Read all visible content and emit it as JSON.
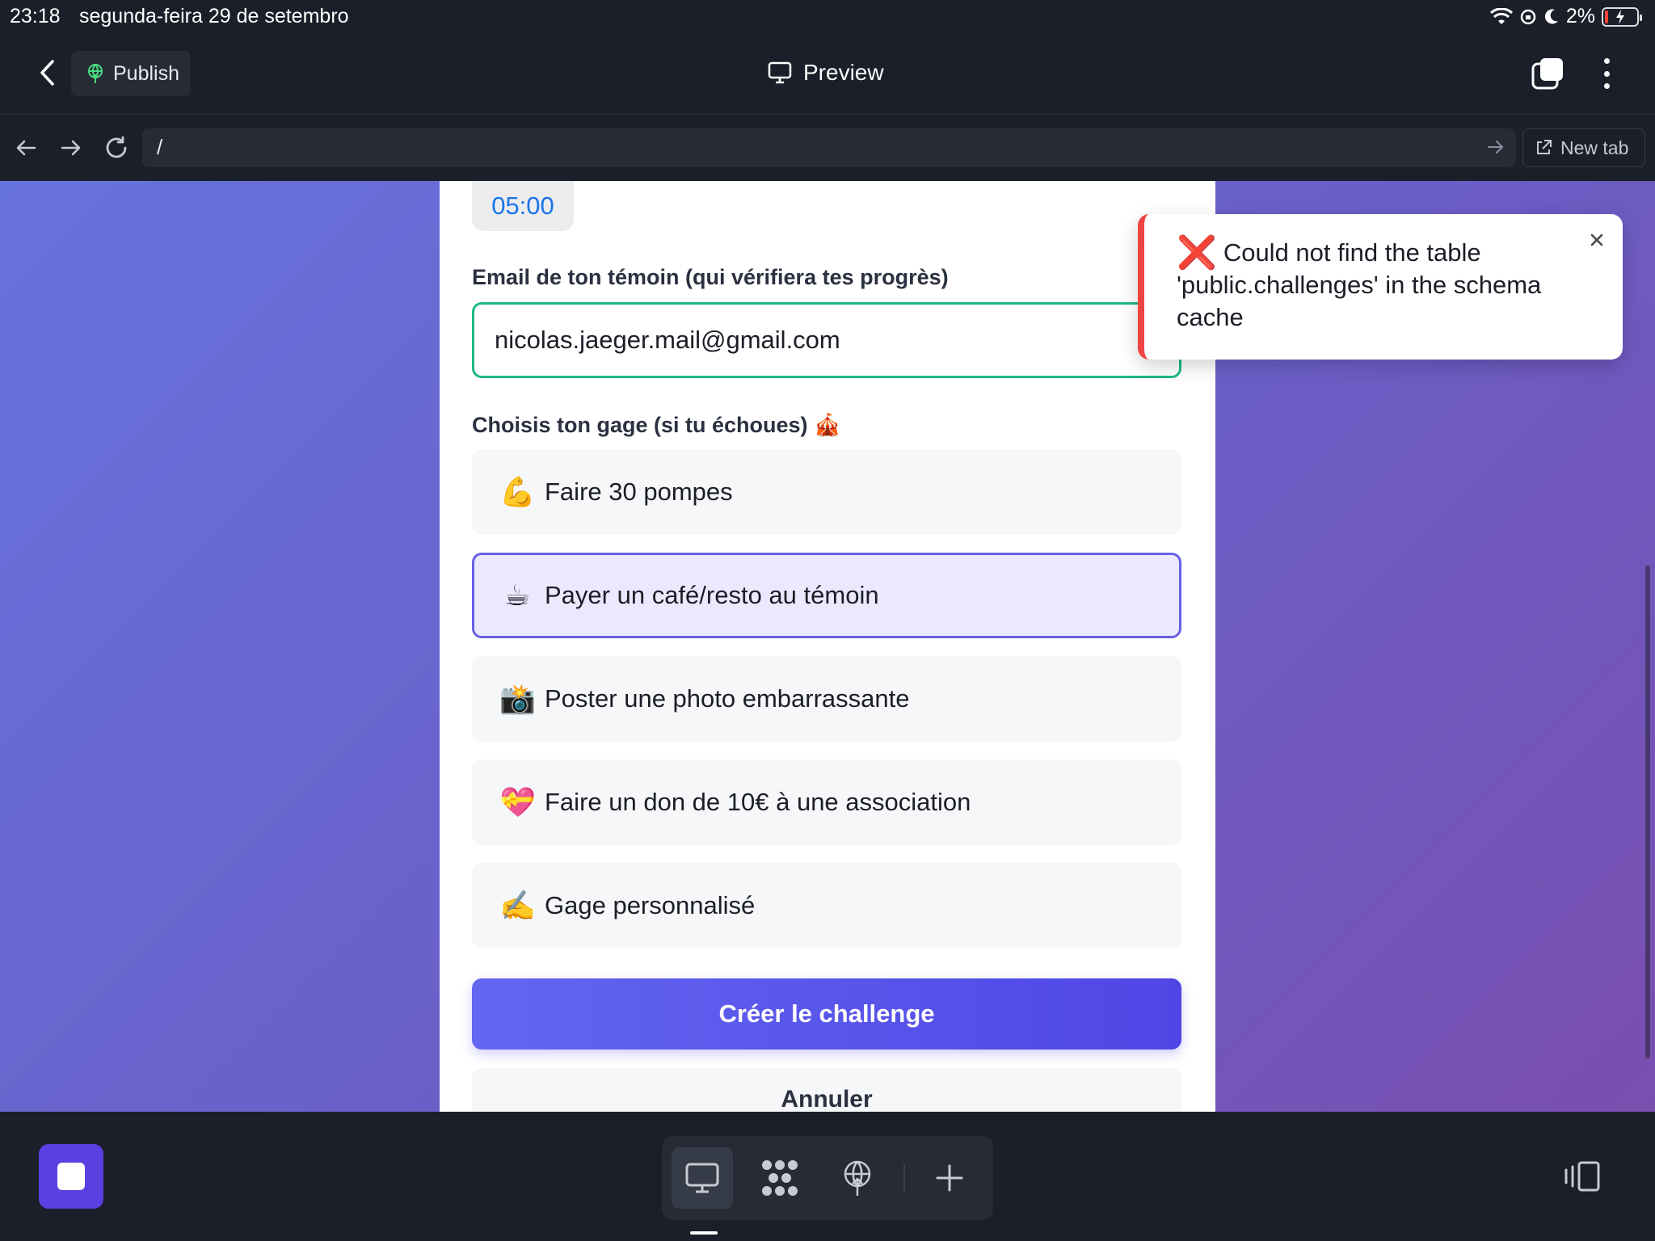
{
  "status": {
    "time": "23:18",
    "date": "segunda-feira 29 de setembro",
    "battery": "2%"
  },
  "appbar": {
    "publish_label": "Publish",
    "preview_label": "Preview"
  },
  "browser": {
    "url": "/",
    "new_tab_label": "New tab"
  },
  "form": {
    "timer_value": "05:00",
    "email_label": "Email de ton témoin (qui vérifiera tes progrès)",
    "email_value": "nicolas.jaeger.mail@gmail.com",
    "gage_label": "Choisis ton gage (si tu échoues) 🎪",
    "options": [
      {
        "emoji": "💪",
        "label": "Faire 30 pompes",
        "selected": false
      },
      {
        "emoji": "☕",
        "label": "Payer un café/resto au témoin",
        "selected": true
      },
      {
        "emoji": "📸",
        "label": "Poster une photo embarrassante",
        "selected": false
      },
      {
        "emoji": "💝",
        "label": "Faire un don de 10€ à une association",
        "selected": false
      },
      {
        "emoji": "✍️",
        "label": "Gage personnalisé",
        "selected": false
      }
    ],
    "submit_label": "Créer le challenge",
    "cancel_label": "Annuler"
  },
  "toast": {
    "icon": "❌",
    "message": "Could not find the table 'public.challenges' in the schema cache"
  },
  "colors": {
    "accent": "#6366f1",
    "success_border": "#1db984",
    "error": "#ef4444",
    "background_gradient_start": "#6773dd",
    "background_gradient_end": "#7a4fb0"
  }
}
